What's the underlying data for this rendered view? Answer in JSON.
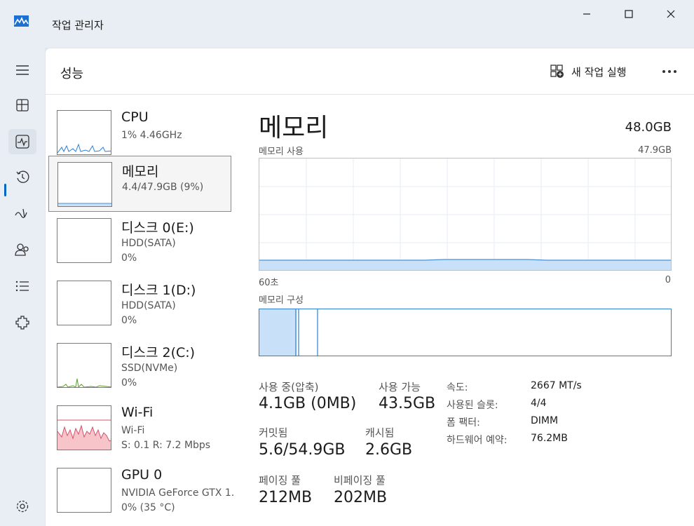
{
  "window": {
    "title": "작업 관리자"
  },
  "header": {
    "page_title": "성능",
    "run_task_label": "새 작업 실행"
  },
  "nav": [
    "menu-icon",
    "processes-icon",
    "performance-icon",
    "app-history-icon",
    "startup-apps-icon",
    "users-icon",
    "details-icon",
    "services-icon",
    "settings-icon"
  ],
  "resources": [
    {
      "name": "CPU",
      "line1": "1% 4.46GHz",
      "line2": ""
    },
    {
      "name": "메모리",
      "line1": "4.4/47.9GB (9%)",
      "line2": ""
    },
    {
      "name": "디스크 0(E:)",
      "line1": "HDD(SATA)",
      "line2": "0%"
    },
    {
      "name": "디스크 1(D:)",
      "line1": "HDD(SATA)",
      "line2": "0%"
    },
    {
      "name": "디스크 2(C:)",
      "line1": "SSD(NVMe)",
      "line2": "0%"
    },
    {
      "name": "Wi-Fi",
      "line1": "Wi-Fi",
      "line2": "S: 0.1 R: 7.2 Mbps"
    },
    {
      "name": "GPU 0",
      "line1": "NVIDIA GeForce GTX 1.",
      "line2": "0% (35 °C)"
    }
  ],
  "detail": {
    "title": "메모리",
    "total": "48.0GB",
    "usage_label": "메모리 사용",
    "usage_max": "47.9GB",
    "time_left": "60초",
    "time_right": "0",
    "composition_label": "메모리 구성",
    "in_use_fraction": 0.09,
    "stats": {
      "in_use_label": "사용 중(압축)",
      "in_use_value": "4.1GB (0MB)",
      "available_label": "사용 가능",
      "available_value": "43.5GB",
      "committed_label": "커밋됨",
      "committed_value": "5.6/54.9GB",
      "cached_label": "캐시됨",
      "cached_value": "2.6GB",
      "paged_label": "페이징 풀",
      "paged_value": "212MB",
      "nonpaged_label": "비페이징 풀",
      "nonpaged_value": "202MB"
    },
    "kv": [
      {
        "label": "속도:",
        "value": "2667 MT/s"
      },
      {
        "label": "사용된 슬롯:",
        "value": "4/4"
      },
      {
        "label": "폼 팩터:",
        "value": "DIMM"
      },
      {
        "label": "하드웨어 예약:",
        "value": "76.2MB"
      }
    ]
  },
  "colors": {
    "accent": "#0067c0",
    "memory_fill": "#c9e1f8",
    "memory_line": "#4b8fd6",
    "wifi_fill": "#f6c4c9",
    "wifi_line": "#d8516a",
    "disk_line": "#5d9b2c",
    "cpu_line": "#2c7fd8"
  }
}
